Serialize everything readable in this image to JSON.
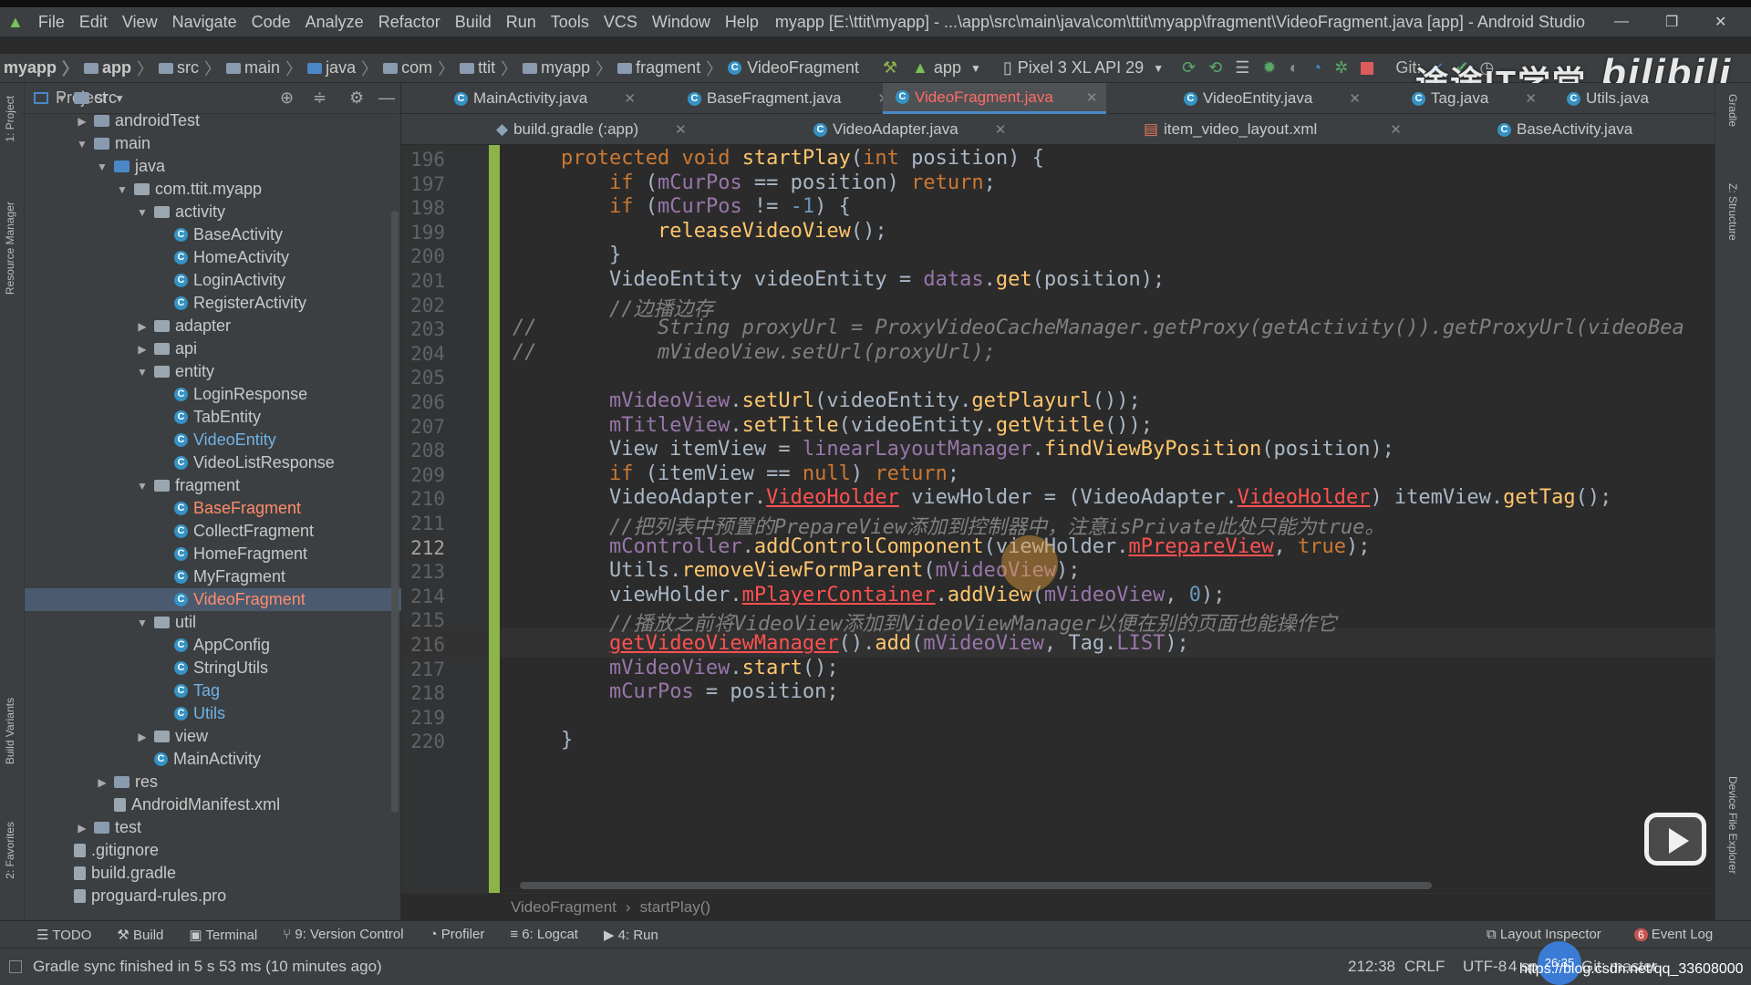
{
  "menu": [
    "File",
    "Edit",
    "View",
    "Navigate",
    "Code",
    "Analyze",
    "Refactor",
    "Build",
    "Run",
    "Tools",
    "VCS",
    "Window",
    "Help"
  ],
  "window_title": "myapp [E:\\ttit\\myapp] - ...\\app\\src\\main\\java\\com\\ttit\\myapp\\fragment\\VideoFragment.java [app] - Android Studio",
  "breadcrumb": [
    "myapp",
    "app",
    "src",
    "main",
    "java",
    "com",
    "ttit",
    "myapp",
    "fragment",
    "VideoFragment"
  ],
  "run_config": "app",
  "device": "Pixel 3 XL API 29",
  "git_label": "Git:",
  "watermark_text": "途途IT学堂",
  "watermark_logo": "bilibili",
  "side_tools_left": [
    "1: Project",
    "Resource Manager",
    "Build Variants",
    "2: Favorites"
  ],
  "side_tools_right": [
    "Gradle",
    "Z: Structure",
    "Device File Explorer"
  ],
  "project_panel": {
    "title": "Project",
    "tree": [
      {
        "label": "src",
        "level": 2,
        "type": "folder",
        "expanded": true
      },
      {
        "label": "androidTest",
        "level": 3,
        "type": "folder",
        "expanded": false
      },
      {
        "label": "main",
        "level": 3,
        "type": "folder",
        "expanded": true
      },
      {
        "label": "java",
        "level": 4,
        "type": "folder",
        "expanded": true
      },
      {
        "label": "com.ttit.myapp",
        "level": 5,
        "type": "package",
        "expanded": true
      },
      {
        "label": "activity",
        "level": 6,
        "type": "package",
        "expanded": true
      },
      {
        "label": "BaseActivity",
        "level": 7,
        "type": "class"
      },
      {
        "label": "HomeActivity",
        "level": 7,
        "type": "class"
      },
      {
        "label": "LoginActivity",
        "level": 7,
        "type": "class"
      },
      {
        "label": "RegisterActivity",
        "level": 7,
        "type": "class"
      },
      {
        "label": "adapter",
        "level": 6,
        "type": "package",
        "expanded": false
      },
      {
        "label": "api",
        "level": 6,
        "type": "package",
        "expanded": false
      },
      {
        "label": "entity",
        "level": 6,
        "type": "package",
        "expanded": true
      },
      {
        "label": "LoginResponse",
        "level": 7,
        "type": "class"
      },
      {
        "label": "TabEntity",
        "level": 7,
        "type": "class"
      },
      {
        "label": "VideoEntity",
        "level": 7,
        "type": "class",
        "highlight": true
      },
      {
        "label": "VideoListResponse",
        "level": 7,
        "type": "class"
      },
      {
        "label": "fragment",
        "level": 6,
        "type": "package",
        "expanded": true
      },
      {
        "label": "BaseFragment",
        "level": 7,
        "type": "class",
        "highlight": true
      },
      {
        "label": "CollectFragment",
        "level": 7,
        "type": "class"
      },
      {
        "label": "HomeFragment",
        "level": 7,
        "type": "class"
      },
      {
        "label": "MyFragment",
        "level": 7,
        "type": "class"
      },
      {
        "label": "VideoFragment",
        "level": 7,
        "type": "class",
        "selected": true,
        "highlight": true
      },
      {
        "label": "util",
        "level": 6,
        "type": "package",
        "expanded": true
      },
      {
        "label": "AppConfig",
        "level": 7,
        "type": "class"
      },
      {
        "label": "StringUtils",
        "level": 7,
        "type": "class"
      },
      {
        "label": "Tag",
        "level": 7,
        "type": "class",
        "highlight": true
      },
      {
        "label": "Utils",
        "level": 7,
        "type": "class",
        "highlight": true
      },
      {
        "label": "view",
        "level": 6,
        "type": "package",
        "expanded": false
      },
      {
        "label": "MainActivity",
        "level": 6,
        "type": "class"
      },
      {
        "label": "res",
        "level": 4,
        "type": "folder",
        "expanded": false
      },
      {
        "label": "AndroidManifest.xml",
        "level": 4,
        "type": "file"
      },
      {
        "label": "test",
        "level": 3,
        "type": "folder",
        "expanded": false
      },
      {
        "label": ".gitignore",
        "level": 2,
        "type": "file"
      },
      {
        "label": "build.gradle",
        "level": 2,
        "type": "file"
      },
      {
        "label": "proguard-rules.pro",
        "level": 2,
        "type": "file"
      }
    ]
  },
  "tabs_row1": [
    {
      "label": "MainActivity.java",
      "active": false
    },
    {
      "label": "BaseFragment.java",
      "active": false
    },
    {
      "label": "VideoFragment.java",
      "active": true
    },
    {
      "label": "VideoEntity.java",
      "active": false
    },
    {
      "label": "Tag.java",
      "active": false
    },
    {
      "label": "Utils.java",
      "active": false
    }
  ],
  "tabs_row2": [
    {
      "label": "build.gradle (:app)",
      "active": false
    },
    {
      "label": "VideoAdapter.java",
      "active": false
    },
    {
      "label": "item_video_layout.xml",
      "active": false
    },
    {
      "label": "BaseActivity.java",
      "active": false
    }
  ],
  "code_lines": [
    {
      "num": "196"
    },
    {
      "num": "197"
    },
    {
      "num": "198"
    },
    {
      "num": "199"
    },
    {
      "num": "200"
    },
    {
      "num": "201"
    },
    {
      "num": "202"
    },
    {
      "num": "203"
    },
    {
      "num": "204"
    },
    {
      "num": "205"
    },
    {
      "num": "206"
    },
    {
      "num": "207"
    },
    {
      "num": "208"
    },
    {
      "num": "209"
    },
    {
      "num": "210"
    },
    {
      "num": "211"
    },
    {
      "num": "212"
    },
    {
      "num": "213"
    },
    {
      "num": "214"
    },
    {
      "num": "215"
    },
    {
      "num": "216"
    },
    {
      "num": "217"
    },
    {
      "num": "218"
    },
    {
      "num": "219"
    },
    {
      "num": "220"
    }
  ],
  "code_text": {
    "l196": "    protected void startPlay(int position) {",
    "l197": "        if (mCurPos == position) return;",
    "l198": "        if (mCurPos != -1) {",
    "l199": "            releaseVideoView();",
    "l200": "        }",
    "l201": "        VideoEntity videoEntity = datas.get(position);",
    "l202": "        //边播边存",
    "l203": "//          String proxyUrl = ProxyVideoCacheManager.getProxy(getActivity()).getProxyUrl(videoBea",
    "l204": "//          mVideoView.setUrl(proxyUrl);",
    "l205": "",
    "l206": "        mVideoView.setUrl(videoEntity.getPlayurl());",
    "l207": "        mTitleView.setTitle(videoEntity.getVtitle());",
    "l208": "        View itemView = linearLayoutManager.findViewByPosition(position);",
    "l209": "        if (itemView == null) return;",
    "l210": "        VideoAdapter.VideoHolder viewHolder = (VideoAdapter.VideoHolder) itemView.getTag();",
    "l211": "        //把列表中预置的PrepareView添加到控制器中，注意isPrivate此处只能为true。",
    "l212": "        mController.addControlComponent(viewHolder.mPrepareView, true);",
    "l213": "        Utils.removeViewFormParent(mVideoView);",
    "l214": "        viewHolder.mPlayerContainer.addView(mVideoView, 0);",
    "l215": "        //播放之前将VideoView添加到VideoViewManager以便在别的页面也能操作它",
    "l216": "        getVideoViewManager().add(mVideoView, Tag.LIST);",
    "l217": "        mVideoView.start();",
    "l218": "        mCurPos = position;",
    "l219": "",
    "l220": "    }"
  },
  "editor_breadcrumb": [
    "VideoFragment",
    "startPlay()"
  ],
  "bottom_tools": [
    "TODO",
    "Build",
    "Terminal",
    "9: Version Control",
    "Profiler",
    "6: Logcat",
    "4: Run",
    "Layout Inspector",
    "Event Log"
  ],
  "event_log_count": "6",
  "status": {
    "message": "Gradle sync finished in 5 s 53 ms (10 minutes ago)",
    "position": "212:38",
    "line_sep": "CRLF",
    "encoding": "UTF-8",
    "indent": "4 spaces",
    "git_branch": "Git: master",
    "timer": "26:35",
    "url": "https://blog.csdn.net/qq_33608000"
  },
  "colors": {
    "keyword": "#cc7832",
    "method": "#ffc66d",
    "field": "#9876aa",
    "number": "#6897bb",
    "comment": "#808080",
    "error": "#ff5050",
    "background": "#2b2b2b",
    "panel": "#3c3f41",
    "selection": "#0d293e"
  }
}
